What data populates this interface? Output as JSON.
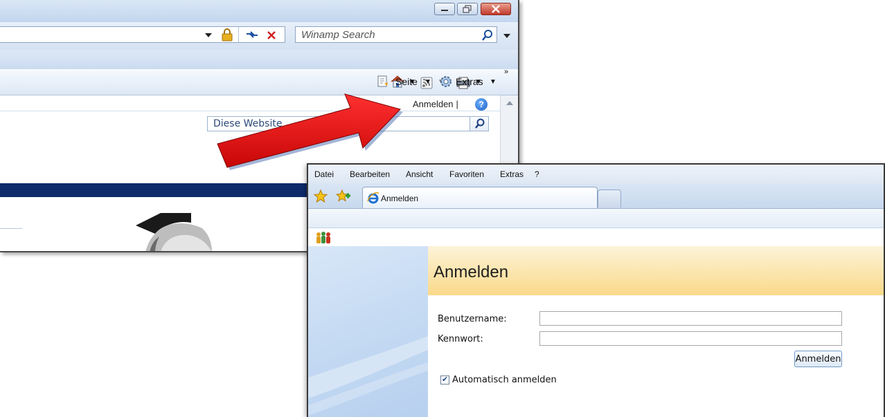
{
  "back_window": {
    "search": {
      "placeholder": "Winamp Search"
    },
    "command_bar": {
      "page": "Seite",
      "extras": "Extras"
    },
    "content": {
      "anmelden_link": "Anmelden",
      "separator": "|",
      "site_search_placeholder": "Diese Website"
    }
  },
  "front_window": {
    "menu": [
      "Datei",
      "Bearbeiten",
      "Ansicht",
      "Favoriten",
      "Extras",
      "?"
    ],
    "tab": {
      "label": "Anmelden"
    },
    "page": {
      "title": "Anmelden",
      "username_label": "Benutzername:",
      "username_value": "",
      "password_label": "Kennwort:",
      "password_value": "",
      "submit_label": "Anmelden",
      "auto_login_label": "Automatisch anmelden",
      "auto_login_checked": true
    }
  },
  "icons": [
    "minimize-icon",
    "restore-icon",
    "close-icon",
    "dropdown-arrow-icon",
    "lock-icon",
    "refresh-icon",
    "stop-icon",
    "search-icon",
    "home-icon",
    "feeds-icon",
    "print-icon",
    "page-icon",
    "gear-icon",
    "help-icon",
    "favorites-star-icon",
    "add-favorites-icon",
    "ie-icon",
    "people-icon",
    "arrow-graphic"
  ],
  "colors": {
    "arrow": "#e41212",
    "header_top": "#fdf3d8",
    "header_bottom": "#fad98a",
    "navy_band": "#0f2a6a"
  }
}
